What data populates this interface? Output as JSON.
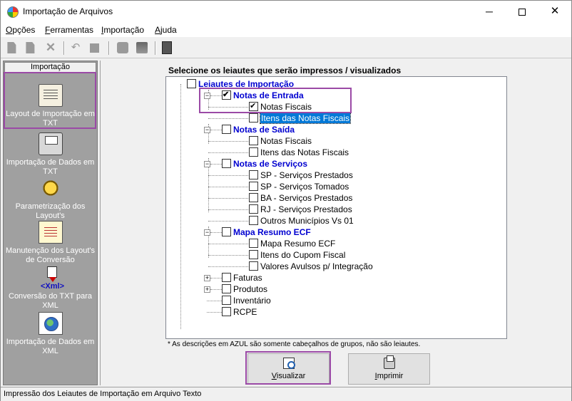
{
  "window": {
    "title": "Importação de Arquivos"
  },
  "menu": [
    {
      "label": "Opções",
      "mnemonic": "O",
      "rest": "pções"
    },
    {
      "label": "Ferramentas",
      "mnemonic": "F",
      "rest": "erramentas"
    },
    {
      "label": "Importação",
      "mnemonic": "I",
      "rest": "mportação"
    },
    {
      "label": "Ajuda",
      "mnemonic": "A",
      "rest": "juda"
    }
  ],
  "sidebar": {
    "header": "Importação",
    "items": [
      {
        "label": "Layout de Importação em TXT",
        "icon": "scroll-icon",
        "active": true
      },
      {
        "label": "Importação de Dados em TXT",
        "icon": "printer-icon"
      },
      {
        "label": "Parametrização dos Layout's",
        "icon": "gear-icon"
      },
      {
        "label": "Manutenção dos Layout's de Conversão",
        "icon": "document-gear-icon"
      },
      {
        "label": "Conversão do TXT para XML",
        "icon": "xml-icon",
        "icon_text": "<Xml>"
      },
      {
        "label": "Importação de Dados em XML",
        "icon": "globe-document-icon"
      }
    ]
  },
  "main": {
    "heading": "Selecione os leiautes que serão impressos / visualizados",
    "footnote": "* As descrições em AZUL são somente cabeçalhos de grupos, não são leiautes.",
    "tree": {
      "root": "Leiautes de Importação",
      "groups": [
        {
          "label": "Notas de Entrada",
          "checked": true,
          "expanded": true,
          "items": [
            {
              "label": "Notas Fiscais",
              "checked": true
            },
            {
              "label": "Itens das Notas Fiscais",
              "checked": false,
              "selected": true
            }
          ]
        },
        {
          "label": "Notas de Saída",
          "checked": false,
          "expanded": true,
          "items": [
            {
              "label": "Notas Fiscais",
              "checked": false
            },
            {
              "label": "Itens das Notas Fiscais",
              "checked": false
            }
          ]
        },
        {
          "label": "Notas de Serviços",
          "checked": false,
          "expanded": true,
          "items": [
            {
              "label": "SP - Serviços Prestados",
              "checked": false
            },
            {
              "label": "SP - Serviços Tomados",
              "checked": false
            },
            {
              "label": "BA - Serviços Prestados",
              "checked": false
            },
            {
              "label": "RJ - Serviços Prestados",
              "checked": false
            },
            {
              "label": "Outros Municípios Vs 01",
              "checked": false
            }
          ]
        },
        {
          "label": "Mapa Resumo ECF",
          "checked": false,
          "expanded": true,
          "items": [
            {
              "label": "Mapa Resumo ECF",
              "checked": false
            },
            {
              "label": "Itens do Cupom Fiscal",
              "checked": false
            },
            {
              "label": "Valores Avulsos p/ Integração",
              "checked": false
            }
          ]
        }
      ],
      "others": [
        {
          "label": "Faturas",
          "expandable": true
        },
        {
          "label": "Produtos",
          "expandable": true
        },
        {
          "label": "Inventário",
          "expandable": false
        },
        {
          "label": "RCPE",
          "expandable": false
        }
      ]
    },
    "buttons": {
      "view_label": "Visualizar",
      "view_mnemonic": "V",
      "view_rest": "isualizar",
      "print_label": "Imprimir",
      "print_mnemonic": "I",
      "print_rest": "mprimir"
    }
  },
  "status": {
    "text": "Impressão dos Leiautes de Importação em Arquivo Texto"
  },
  "colors": {
    "group_text": "#0000d0",
    "highlight_border": "#9b4aa6",
    "selection": "#0078d7",
    "sidebar_bg": "#a0a0a0"
  }
}
